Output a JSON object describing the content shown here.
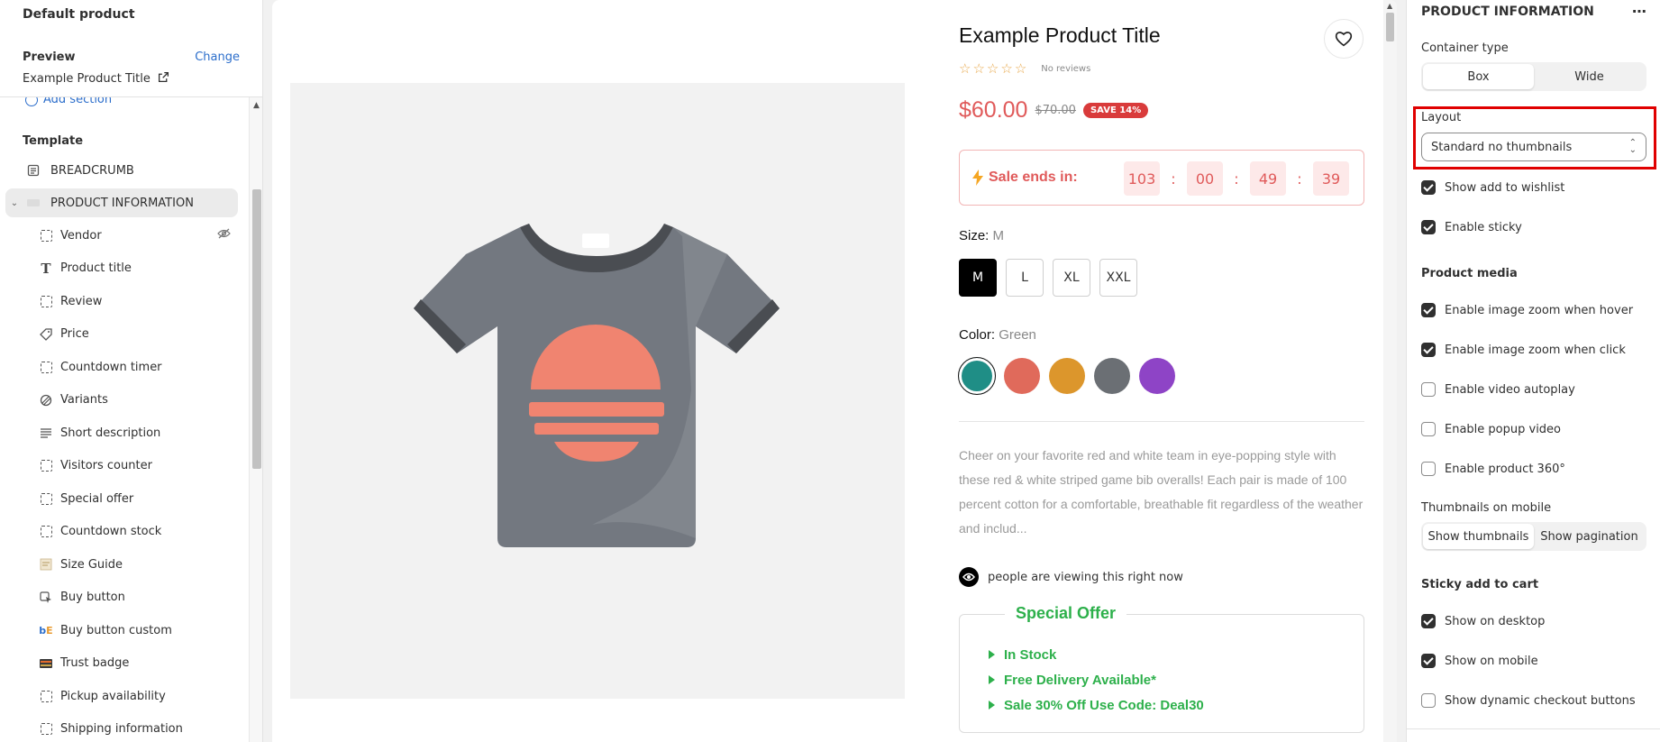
{
  "left": {
    "title": "Default product",
    "preview_label": "Preview",
    "change_label": "Change",
    "product_name": "Example Product Title",
    "add_section": "Add section",
    "template_label": "Template",
    "breadcrumb": "BREADCRUMB",
    "section": "PRODUCT INFORMATION",
    "blocks": [
      {
        "label": "Vendor",
        "icon": "dashed-square-icon"
      },
      {
        "label": "Product title",
        "icon": "text-icon"
      },
      {
        "label": "Review",
        "icon": "dashed-square-icon"
      },
      {
        "label": "Price",
        "icon": "price-tag-icon"
      },
      {
        "label": "Countdown timer",
        "icon": "dashed-square-icon"
      },
      {
        "label": "Variants",
        "icon": "variants-icon"
      },
      {
        "label": "Short description",
        "icon": "paragraph-icon"
      },
      {
        "label": "Visitors counter",
        "icon": "dashed-square-icon"
      },
      {
        "label": "Special offer",
        "icon": "dashed-square-icon"
      },
      {
        "label": "Countdown stock",
        "icon": "dashed-square-icon"
      },
      {
        "label": "Size Guide",
        "icon": "size-guide-icon"
      },
      {
        "label": "Buy button",
        "icon": "cursor-icon"
      },
      {
        "label": "Buy button custom",
        "icon": "custom-buy-icon"
      },
      {
        "label": "Trust badge",
        "icon": "trust-badge-icon"
      },
      {
        "label": "Pickup availability",
        "icon": "dashed-square-icon"
      },
      {
        "label": "Shipping information",
        "icon": "dashed-square-icon"
      }
    ]
  },
  "product": {
    "title": "Example Product Title",
    "no_reviews": "No reviews",
    "price": "$60.00",
    "compare_price": "$70.00",
    "save_badge": "SAVE 14%",
    "timer_label": "Sale ends in:",
    "timer": [
      "103",
      "00",
      "49",
      "39"
    ],
    "size_label": "Size:",
    "size_selected": "M",
    "sizes": [
      "M",
      "L",
      "XL",
      "XXL"
    ],
    "color_label": "Color:",
    "color_selected": "Green",
    "colors": [
      "#1f8e86",
      "#e06a5b",
      "#dc962c",
      "#6b6f74",
      "#8e44c6"
    ],
    "description": "Cheer on your favorite red and white team in eye-popping style with these red & white striped game bib overalls! Each pair is made of 100 percent cotton for a comfortable, breathable fit regardless of the weather and includ...",
    "viewers": "people are viewing this right now",
    "offer_title": "Special Offer",
    "offer_items": [
      "In Stock",
      "Free Delivery Available*",
      "Sale 30% Off Use Code: Deal30"
    ]
  },
  "settings": {
    "title": "PRODUCT INFORMATION",
    "container_label": "Container type",
    "container_options": [
      "Box",
      "Wide"
    ],
    "layout_label": "Layout",
    "layout_value": "Standard no thumbnails",
    "show_wishlist": "Show add to wishlist",
    "enable_sticky": "Enable sticky",
    "media_heading": "Product media",
    "zoom_hover": "Enable image zoom when hover",
    "zoom_click": "Enable image zoom when click",
    "video_autoplay": "Enable video autoplay",
    "popup_video": "Enable popup video",
    "product_360": "Enable product 360°",
    "thumbs_mobile_label": "Thumbnails on mobile",
    "thumbs_options": [
      "Show thumbnails",
      "Show pagination"
    ],
    "sticky_heading": "Sticky add to cart",
    "show_desktop": "Show on desktop",
    "show_mobile": "Show on mobile",
    "dynamic_checkout": "Show dynamic checkout buttons"
  },
  "colors": {
    "accent_link": "#2c6ecb",
    "sale_red": "#e05a5a",
    "offer_green": "#2db04b",
    "highlight_red": "#e00000"
  }
}
